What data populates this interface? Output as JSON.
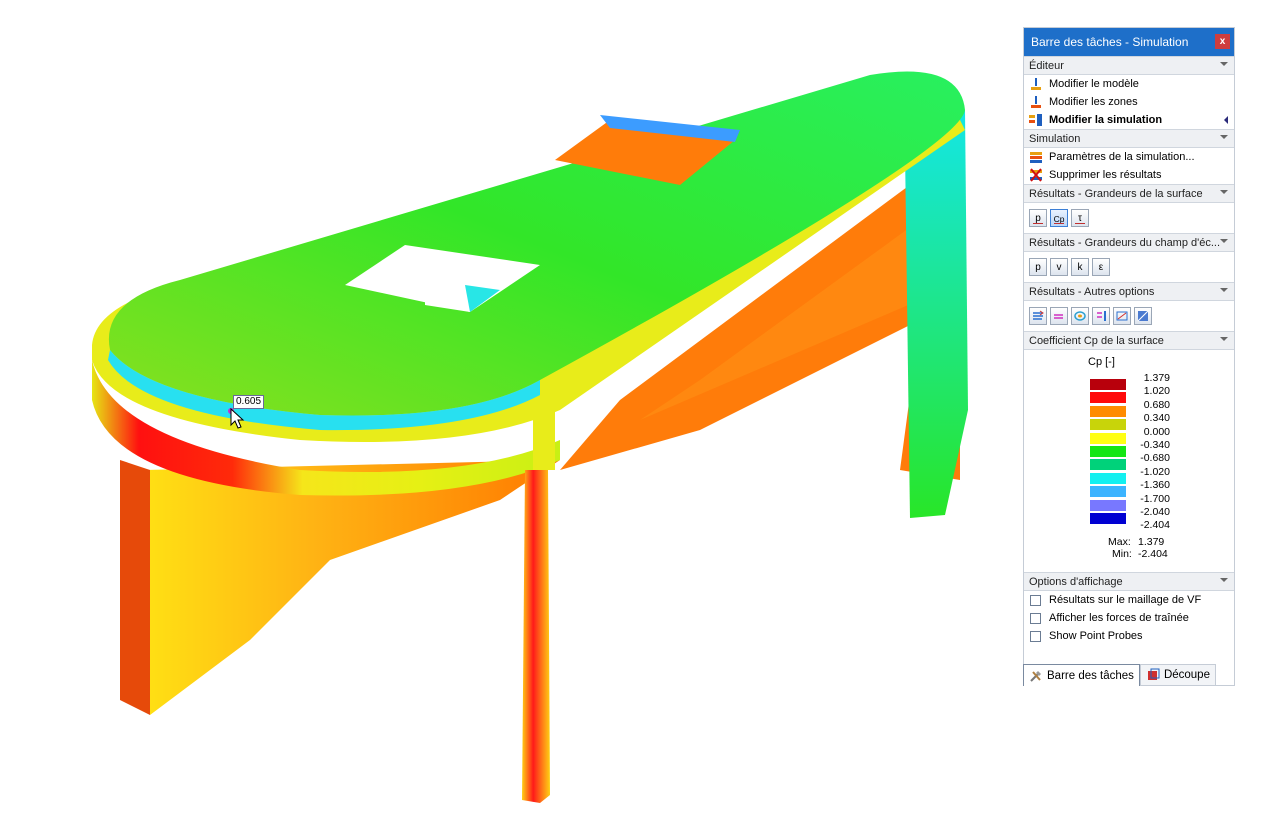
{
  "viewport": {
    "probe_value": "0.605"
  },
  "taskpane": {
    "title": "Barre des tâches - Simulation",
    "close_label": "x",
    "editor": {
      "header": "Éditeur",
      "items": [
        "Modifier le modèle",
        "Modifier les zones",
        "Modifier la simulation"
      ]
    },
    "simulation": {
      "header": "Simulation",
      "items": [
        "Paramètres de la simulation...",
        "Supprimer les résultats"
      ]
    },
    "surface_results": {
      "header": "Résultats - Grandeurs de la surface",
      "buttons": [
        "p",
        "Cp",
        "τ"
      ]
    },
    "field_results": {
      "header": "Résultats - Grandeurs du champ d'éc...",
      "buttons": [
        "p",
        "v",
        "k",
        "ε"
      ]
    },
    "other_options": {
      "header": "Résultats - Autres options",
      "icons": [
        "streamlines-icon",
        "arrows-icon",
        "isosurface-icon",
        "vector-icon",
        "slice-icon",
        "mesh-icon"
      ]
    },
    "legend": {
      "header": "Coefficient Cp de la surface",
      "title": "Cp [-]",
      "entries": [
        {
          "label": "1.379",
          "color": "#b8000c"
        },
        {
          "label": "1.020",
          "color": "#ff0a0a"
        },
        {
          "label": "0.680",
          "color": "#ff8c00"
        },
        {
          "label": "0.340",
          "color": "#c8d40a"
        },
        {
          "label": "0.000",
          "color": "#ffff14"
        },
        {
          "label": "-0.340",
          "color": "#14e614"
        },
        {
          "label": "-0.680",
          "color": "#00d27a"
        },
        {
          "label": "-1.020",
          "color": "#14f0f0"
        },
        {
          "label": "-1.360",
          "color": "#3cb4ff"
        },
        {
          "label": "-1.700",
          "color": "#7878ff"
        },
        {
          "label": "-2.040",
          "color": "#0000d2"
        }
      ],
      "last_label": "-2.404",
      "max_label": "Max:",
      "max_value": "1.379",
      "min_label": "Min:",
      "min_value": "-2.404"
    },
    "display_options": {
      "header": "Options d'affichage",
      "checkboxes": [
        "Résultats sur le maillage de VF",
        "Afficher les forces de traînée",
        "Show Point Probes"
      ]
    }
  },
  "bottom_tabs": [
    "Barre des tâches",
    "Découpe"
  ]
}
